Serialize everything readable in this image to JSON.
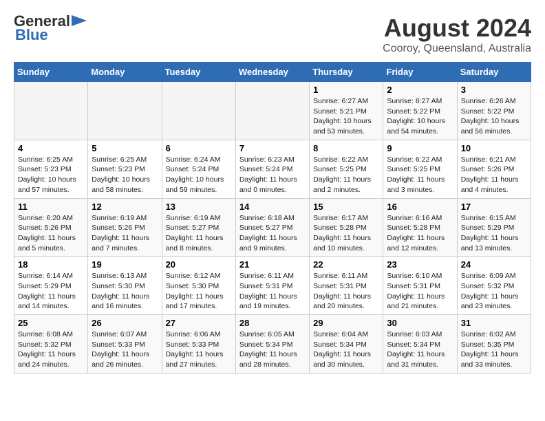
{
  "header": {
    "logo_line1": "General",
    "logo_line2": "Blue",
    "title": "August 2024",
    "subtitle": "Cooroy, Queensland, Australia"
  },
  "weekdays": [
    "Sunday",
    "Monday",
    "Tuesday",
    "Wednesday",
    "Thursday",
    "Friday",
    "Saturday"
  ],
  "weeks": [
    [
      {
        "day": "",
        "info": ""
      },
      {
        "day": "",
        "info": ""
      },
      {
        "day": "",
        "info": ""
      },
      {
        "day": "",
        "info": ""
      },
      {
        "day": "1",
        "info": "Sunrise: 6:27 AM\nSunset: 5:21 PM\nDaylight: 10 hours\nand 53 minutes."
      },
      {
        "day": "2",
        "info": "Sunrise: 6:27 AM\nSunset: 5:22 PM\nDaylight: 10 hours\nand 54 minutes."
      },
      {
        "day": "3",
        "info": "Sunrise: 6:26 AM\nSunset: 5:22 PM\nDaylight: 10 hours\nand 56 minutes."
      }
    ],
    [
      {
        "day": "4",
        "info": "Sunrise: 6:25 AM\nSunset: 5:23 PM\nDaylight: 10 hours\nand 57 minutes."
      },
      {
        "day": "5",
        "info": "Sunrise: 6:25 AM\nSunset: 5:23 PM\nDaylight: 10 hours\nand 58 minutes."
      },
      {
        "day": "6",
        "info": "Sunrise: 6:24 AM\nSunset: 5:24 PM\nDaylight: 10 hours\nand 59 minutes."
      },
      {
        "day": "7",
        "info": "Sunrise: 6:23 AM\nSunset: 5:24 PM\nDaylight: 11 hours\nand 0 minutes."
      },
      {
        "day": "8",
        "info": "Sunrise: 6:22 AM\nSunset: 5:25 PM\nDaylight: 11 hours\nand 2 minutes."
      },
      {
        "day": "9",
        "info": "Sunrise: 6:22 AM\nSunset: 5:25 PM\nDaylight: 11 hours\nand 3 minutes."
      },
      {
        "day": "10",
        "info": "Sunrise: 6:21 AM\nSunset: 5:26 PM\nDaylight: 11 hours\nand 4 minutes."
      }
    ],
    [
      {
        "day": "11",
        "info": "Sunrise: 6:20 AM\nSunset: 5:26 PM\nDaylight: 11 hours\nand 5 minutes."
      },
      {
        "day": "12",
        "info": "Sunrise: 6:19 AM\nSunset: 5:26 PM\nDaylight: 11 hours\nand 7 minutes."
      },
      {
        "day": "13",
        "info": "Sunrise: 6:19 AM\nSunset: 5:27 PM\nDaylight: 11 hours\nand 8 minutes."
      },
      {
        "day": "14",
        "info": "Sunrise: 6:18 AM\nSunset: 5:27 PM\nDaylight: 11 hours\nand 9 minutes."
      },
      {
        "day": "15",
        "info": "Sunrise: 6:17 AM\nSunset: 5:28 PM\nDaylight: 11 hours\nand 10 minutes."
      },
      {
        "day": "16",
        "info": "Sunrise: 6:16 AM\nSunset: 5:28 PM\nDaylight: 11 hours\nand 12 minutes."
      },
      {
        "day": "17",
        "info": "Sunrise: 6:15 AM\nSunset: 5:29 PM\nDaylight: 11 hours\nand 13 minutes."
      }
    ],
    [
      {
        "day": "18",
        "info": "Sunrise: 6:14 AM\nSunset: 5:29 PM\nDaylight: 11 hours\nand 14 minutes."
      },
      {
        "day": "19",
        "info": "Sunrise: 6:13 AM\nSunset: 5:30 PM\nDaylight: 11 hours\nand 16 minutes."
      },
      {
        "day": "20",
        "info": "Sunrise: 6:12 AM\nSunset: 5:30 PM\nDaylight: 11 hours\nand 17 minutes."
      },
      {
        "day": "21",
        "info": "Sunrise: 6:11 AM\nSunset: 5:31 PM\nDaylight: 11 hours\nand 19 minutes."
      },
      {
        "day": "22",
        "info": "Sunrise: 6:11 AM\nSunset: 5:31 PM\nDaylight: 11 hours\nand 20 minutes."
      },
      {
        "day": "23",
        "info": "Sunrise: 6:10 AM\nSunset: 5:31 PM\nDaylight: 11 hours\nand 21 minutes."
      },
      {
        "day": "24",
        "info": "Sunrise: 6:09 AM\nSunset: 5:32 PM\nDaylight: 11 hours\nand 23 minutes."
      }
    ],
    [
      {
        "day": "25",
        "info": "Sunrise: 6:08 AM\nSunset: 5:32 PM\nDaylight: 11 hours\nand 24 minutes."
      },
      {
        "day": "26",
        "info": "Sunrise: 6:07 AM\nSunset: 5:33 PM\nDaylight: 11 hours\nand 26 minutes."
      },
      {
        "day": "27",
        "info": "Sunrise: 6:06 AM\nSunset: 5:33 PM\nDaylight: 11 hours\nand 27 minutes."
      },
      {
        "day": "28",
        "info": "Sunrise: 6:05 AM\nSunset: 5:34 PM\nDaylight: 11 hours\nand 28 minutes."
      },
      {
        "day": "29",
        "info": "Sunrise: 6:04 AM\nSunset: 5:34 PM\nDaylight: 11 hours\nand 30 minutes."
      },
      {
        "day": "30",
        "info": "Sunrise: 6:03 AM\nSunset: 5:34 PM\nDaylight: 11 hours\nand 31 minutes."
      },
      {
        "day": "31",
        "info": "Sunrise: 6:02 AM\nSunset: 5:35 PM\nDaylight: 11 hours\nand 33 minutes."
      }
    ]
  ]
}
